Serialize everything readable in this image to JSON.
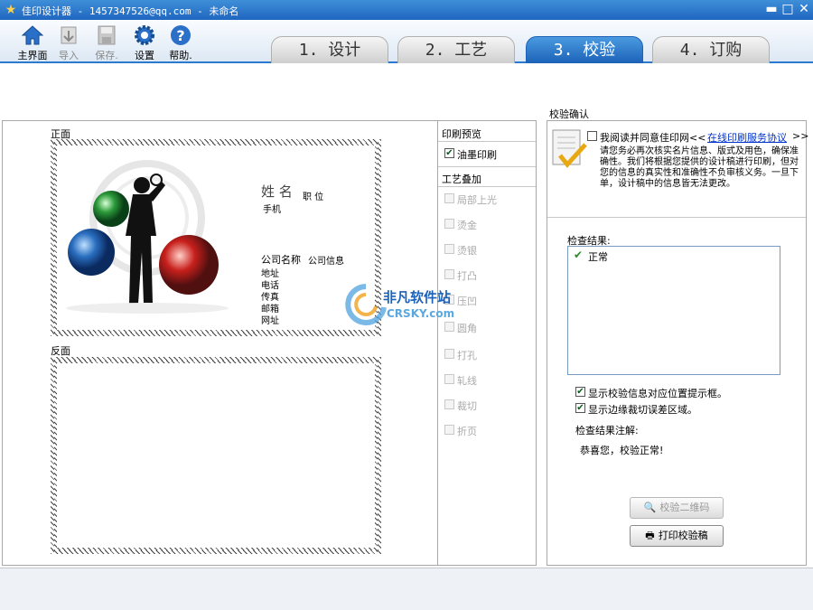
{
  "window": {
    "title": "佳印设计器 - 1457347526@qq.com - 未命名",
    "controls": {
      "minimize": "▬",
      "maximize": "□",
      "close": "✕"
    }
  },
  "toolbar": {
    "items": [
      {
        "label": "主界面",
        "icon": "home-icon",
        "enabled": true
      },
      {
        "label": "导入",
        "icon": "import-icon",
        "enabled": false
      },
      {
        "label": "保存.",
        "icon": "save-icon",
        "enabled": false
      },
      {
        "label": "设置",
        "icon": "gear-icon",
        "enabled": true
      },
      {
        "label": "帮助.",
        "icon": "help-icon",
        "enabled": true
      }
    ]
  },
  "tabs": [
    {
      "label": "1. 设计",
      "active": false
    },
    {
      "label": "2. 工艺",
      "active": false
    },
    {
      "label": "3. 校验",
      "active": true
    },
    {
      "label": "4. 订购",
      "active": false
    }
  ],
  "preview": {
    "front_label": "正面",
    "back_label": "反面",
    "card": {
      "name": "姓 名",
      "position": "职 位",
      "mobile": "手机",
      "company": "公司名称",
      "company_info": "公司信息",
      "fields": [
        "地址",
        "电话",
        "传真",
        "邮箱",
        "网址"
      ]
    }
  },
  "print_options": {
    "preview_title": "印刷预览",
    "ink_print": {
      "label": "油墨印刷",
      "checked": true
    },
    "craft_title": "工艺叠加",
    "crafts": [
      "局部上光",
      "烫金",
      "烫银",
      "打凸",
      "压凹",
      "圆角",
      "打孔",
      "轧线",
      "裁切",
      "折页"
    ]
  },
  "verify": {
    "title": "校验确认",
    "agree_text": "我阅读并同意佳印网<<",
    "agree_link": "在线印刷服务协议",
    "agree_tail": ">>",
    "notice": "请您务必再次核实名片信息、版式及用色，确保准确性。我们将根据您提供的设计稿进行印刷，但对您的信息的真实性和准确性不负审核义务。一旦下单，设计稿中的信息皆无法更改。",
    "result_label": "检查结果:",
    "results": [
      "正常"
    ],
    "show_position": {
      "label": "显示校验信息对应位置提示框。",
      "checked": true
    },
    "show_bleed": {
      "label": "显示边缘裁切误差区域。",
      "checked": true
    },
    "note_label": "检查结果注解:",
    "note_text": "恭喜您，校验正常!",
    "qr_button": "校验二维码",
    "print_button": "打印校验稿"
  },
  "watermark": {
    "cn": "非凡软件站",
    "en": "CRSKY.com"
  },
  "colors": {
    "accent": "#1c62b8",
    "link": "#0033cc",
    "check": "#2a8a2a"
  }
}
